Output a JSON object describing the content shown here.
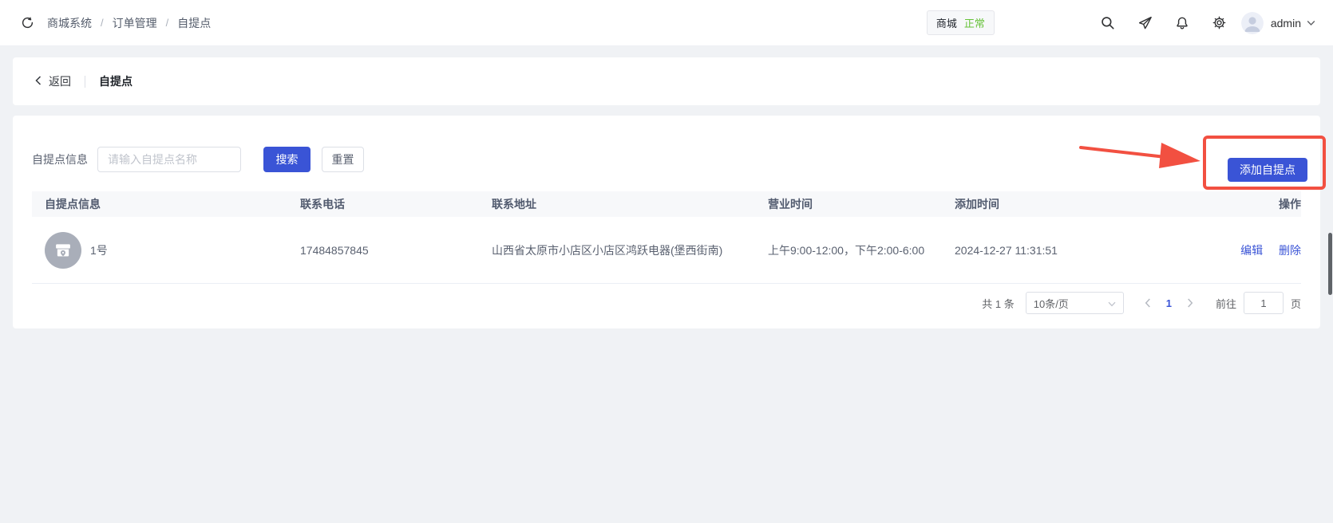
{
  "header": {
    "breadcrumb": {
      "items": [
        "商城系统",
        "订单管理",
        "自提点"
      ],
      "separator": "/"
    },
    "shop_badge": {
      "name": "商城",
      "status": "正常"
    },
    "username": "admin"
  },
  "back_bar": {
    "back": "返回",
    "title": "自提点"
  },
  "toolbar": {
    "filter_label": "自提点信息",
    "search_placeholder": "请输入自提点名称",
    "search_button": "搜索",
    "reset_button": "重置",
    "add_button": "添加自提点"
  },
  "table": {
    "columns": [
      "自提点信息",
      "联系电话",
      "联系地址",
      "营业时间",
      "添加时间",
      "操作"
    ],
    "rows": [
      {
        "name": "1号",
        "phone": "17484857845",
        "address": "山西省太原市小店区小店区鸿跃电器(堡西街南)",
        "business_hours": "上午9:00-12:00，下午2:00-6:00",
        "added_time": "2024-12-27 11:31:51",
        "edit": "编辑",
        "delete": "删除"
      }
    ]
  },
  "pagination": {
    "total_text": "共 1 条",
    "page_size": "10条/页",
    "current_page": "1",
    "goto_label": "前往",
    "goto_value": "1",
    "page_unit": "页"
  },
  "colors": {
    "primary_blue": "#3a54d6",
    "annotation_red": "#f25041",
    "status_green": "#67c23a",
    "table_header_bg": "#f7f8fa"
  }
}
